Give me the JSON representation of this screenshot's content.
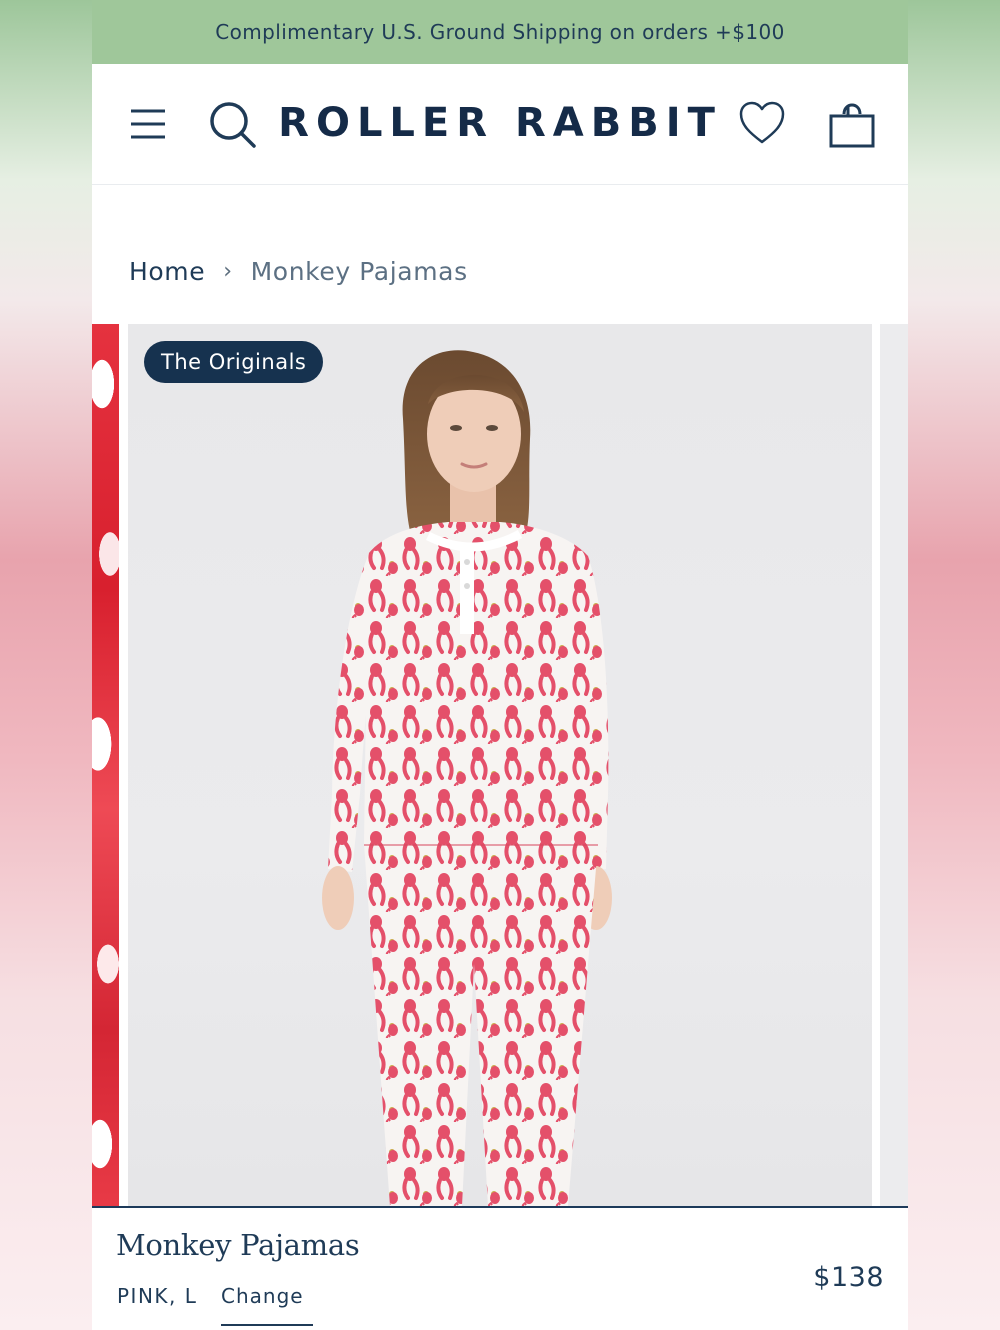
{
  "promo": {
    "text": "Complimentary U.S. Ground Shipping on orders +$100"
  },
  "header": {
    "logo": "ROLLER RABBIT",
    "icons": [
      "menu-icon",
      "search-icon",
      "heart-icon",
      "shopping-bag-icon"
    ]
  },
  "breadcrumb": {
    "home": "Home",
    "separator": "›",
    "current": "Monkey Pajamas"
  },
  "gallery": {
    "badge": "The Originals"
  },
  "product": {
    "name": "Monkey Pajamas",
    "variant": "PINK, L",
    "change_label": "Change",
    "price": "$138"
  },
  "colors": {
    "promo_bg": "#9fc79a",
    "navy": "#16324f",
    "text": "#1f3b57",
    "print_pink": "#e4506a"
  }
}
